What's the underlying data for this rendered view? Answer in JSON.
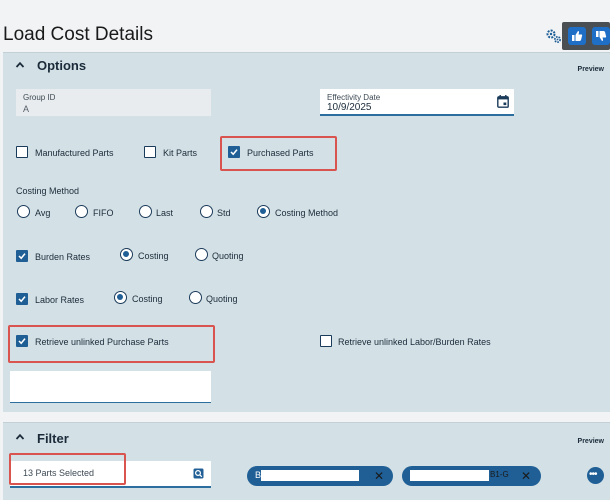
{
  "page": {
    "title": "Load Cost Details"
  },
  "header": {
    "gear_icon": "settings-gears-icon",
    "vote_icons": [
      "thumbs-up-icon",
      "thumbs-down-icon"
    ]
  },
  "options": {
    "title": "Options",
    "preview": "Preview",
    "group_id": {
      "label": "Group ID",
      "value": "A"
    },
    "effectivity_date": {
      "label": "Effectivity Date",
      "value": "10/9/2025"
    },
    "part_types": [
      {
        "label": "Manufactured Parts",
        "checked": false
      },
      {
        "label": "Kit Parts",
        "checked": false
      },
      {
        "label": "Purchased Parts",
        "checked": true
      }
    ],
    "costing_method": {
      "label": "Costing Method",
      "options": [
        "Avg",
        "FIFO",
        "Last",
        "Std",
        "Costing Method"
      ],
      "selected": "Costing Method"
    },
    "burden_rates": {
      "label": "Burden Rates",
      "checked": true,
      "options": [
        "Costing",
        "Quoting"
      ],
      "selected": "Costing"
    },
    "labor_rates": {
      "label": "Labor Rates",
      "checked": true,
      "options": [
        "Costing",
        "Quoting"
      ],
      "selected": "Costing"
    },
    "retrieve_unlinked_purchase": {
      "label": "Retrieve unlinked Purchase Parts",
      "checked": true
    },
    "retrieve_unlinked_labor": {
      "label": "Retrieve unlinked Labor/Burden Rates",
      "checked": false
    }
  },
  "filter": {
    "title": "Filter",
    "preview": "Preview",
    "parts_selected": "13 Parts Selected",
    "chips": [
      {
        "prefix": "B",
        "suffix": ""
      },
      {
        "prefix": "",
        "suffix": "B1-G"
      }
    ],
    "more_label": "•••"
  },
  "colors": {
    "accent": "#1f5f96",
    "panel": "#d3e0e5",
    "highlight": "#d9534f"
  }
}
